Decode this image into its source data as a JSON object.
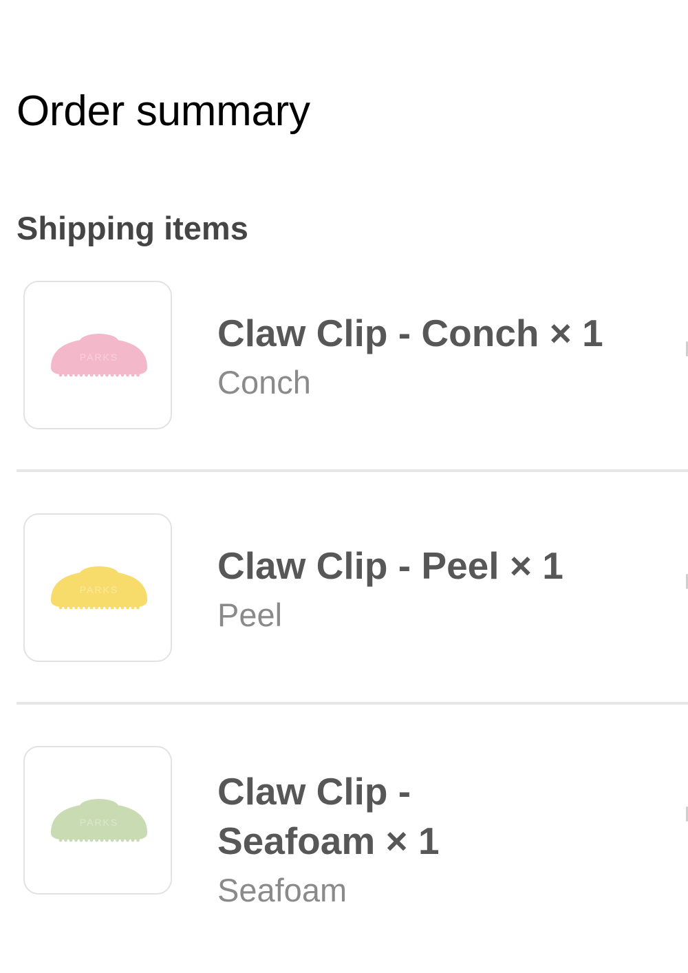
{
  "header": {
    "title": "Order summary"
  },
  "section": {
    "label": "Shipping items"
  },
  "items": [
    {
      "name": "Claw Clip - Conch × 1",
      "variant": "Conch",
      "color": "#f4b8cb",
      "thumb_text": "PARKS"
    },
    {
      "name": "Claw Clip - Peel × 1",
      "variant": "Peel",
      "color": "#f7dc6c",
      "thumb_text": "PARKS"
    },
    {
      "name": "Claw Clip - Seafoam × 1",
      "variant": "Seafoam",
      "color": "#c8dbb3",
      "thumb_text": "PARKS"
    }
  ]
}
